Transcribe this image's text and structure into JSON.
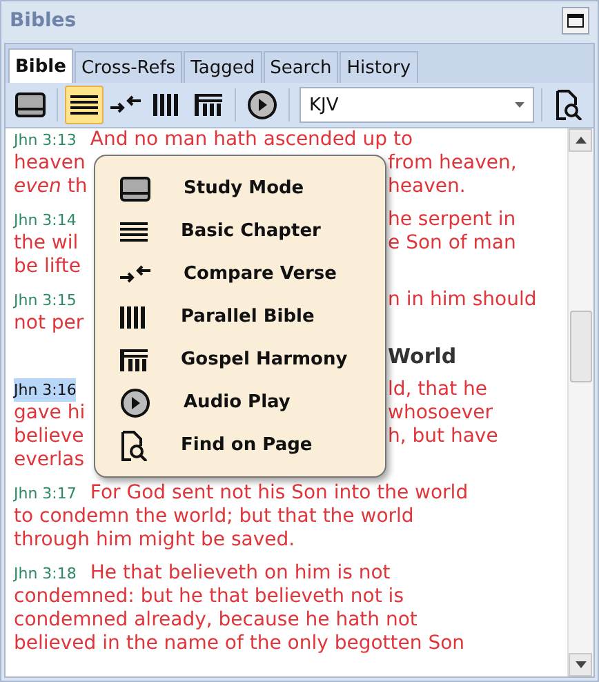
{
  "window": {
    "title": "Bibles"
  },
  "tabs": [
    {
      "label": "Bible",
      "selected": true
    },
    {
      "label": "Cross-Refs",
      "selected": false
    },
    {
      "label": "Tagged",
      "selected": false
    },
    {
      "label": "Search",
      "selected": false
    },
    {
      "label": "History",
      "selected": false
    }
  ],
  "toolbar": {
    "view_buttons": [
      {
        "kind": "study",
        "selected": false
      },
      {
        "kind": "basic",
        "selected": true
      },
      {
        "kind": "compare",
        "selected": false
      },
      {
        "kind": "parallel",
        "selected": false
      },
      {
        "kind": "harmony",
        "selected": false
      }
    ],
    "audio_button": {
      "kind": "audio",
      "selected": false
    },
    "version_select": {
      "value": "KJV"
    },
    "find_button": {
      "kind": "find",
      "selected": false
    }
  },
  "content": {
    "lines": [
      {
        "kind": "verse",
        "ref": "Jhn 3:13",
        "ref_selected": false,
        "left": "And no man hath ascended up to"
      },
      {
        "kind": "verse",
        "left": "heaven",
        "right": "from heaven,"
      },
      {
        "kind": "verse",
        "left": "*even* th",
        "right": "heaven."
      },
      {
        "kind": "verse",
        "ref": "Jhn 3:14",
        "ref_selected": false,
        "right": "he serpent in"
      },
      {
        "kind": "verse",
        "left": "the wil",
        "right": "e Son of man"
      },
      {
        "kind": "verse",
        "left": "be lifte"
      },
      {
        "kind": "verse",
        "ref": "Jhn 3:15",
        "ref_selected": false,
        "right": "n in him should"
      },
      {
        "kind": "verse",
        "left": "not per"
      },
      {
        "kind": "heading",
        "right": "World"
      },
      {
        "kind": "verse",
        "ref": "Jhn 3:16",
        "ref_selected": true,
        "right": "ld, that he"
      },
      {
        "kind": "verse",
        "left": "gave hi",
        "right": "whosoever"
      },
      {
        "kind": "verse",
        "left": "believe",
        "right": "h, but have"
      },
      {
        "kind": "verse",
        "left": "everlas"
      },
      {
        "kind": "verse",
        "ref": "Jhn 3:17",
        "ref_selected": false,
        "left": "For God sent not his Son into the world"
      },
      {
        "kind": "verse",
        "left": "to condemn the world; but that the world"
      },
      {
        "kind": "verse",
        "left": "through him might be saved."
      },
      {
        "kind": "verse",
        "ref": "Jhn 3:18",
        "ref_selected": false,
        "left": "He that believeth on him is not"
      },
      {
        "kind": "verse",
        "left": "condemned: but he that believeth not is"
      },
      {
        "kind": "verse",
        "left": "condemned already, because he hath not"
      },
      {
        "kind": "verse",
        "left": "believed in the name of the only begotten Son"
      }
    ]
  },
  "menu": {
    "items": [
      {
        "kind": "study",
        "label": "Study Mode"
      },
      {
        "kind": "basic",
        "label": "Basic Chapter"
      },
      {
        "kind": "compare",
        "label": "Compare Verse"
      },
      {
        "kind": "parallel",
        "label": "Parallel Bible"
      },
      {
        "kind": "harmony",
        "label": "Gospel Harmony"
      },
      {
        "kind": "audio",
        "label": "Audio Play"
      },
      {
        "kind": "find",
        "label": "Find on Page"
      }
    ]
  }
}
